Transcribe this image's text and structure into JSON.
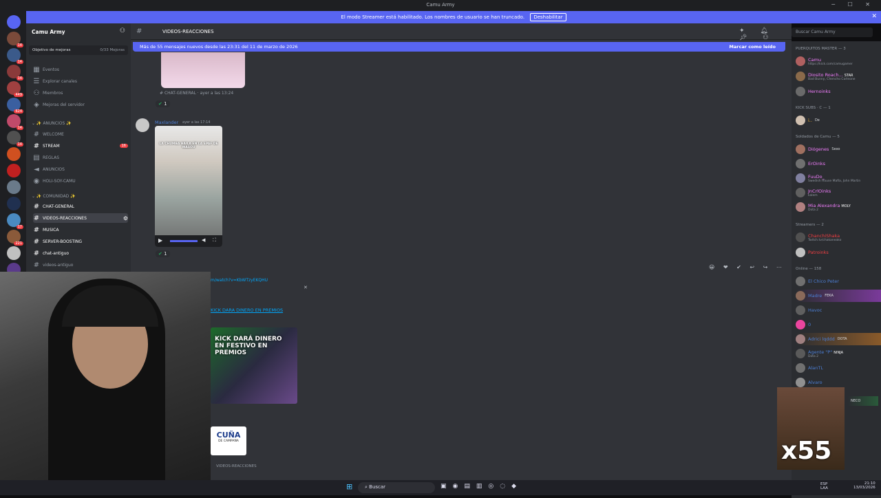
{
  "window": {
    "title": "Camu Army"
  },
  "banner": {
    "text": "El modo Streamer está habilitado. Los nombres de usuario se han truncado.",
    "button": "Deshabilitar"
  },
  "server": {
    "name": "Camu Army",
    "boost_goal": "Objetivo de mejoras",
    "boost_count": "0/33 Mejoras"
  },
  "nav": {
    "events": "Eventos",
    "explore": "Explorar canales",
    "members": "Miembros",
    "boosts": "Mejoras del servidor"
  },
  "categories": {
    "announcements": "ANUNCIOS",
    "community": "COMUNIDAD"
  },
  "channels": [
    "WELCOME",
    "STREAM",
    "REGLAS",
    "ANUNCIOS",
    "HOLI-SOY-CAMU",
    "CHAT-GENERAL",
    "VIDEOS-REACCIONES",
    "MUSICA",
    "SERVER-BOOSTING",
    "chat-antiguo",
    "videos-antiguo"
  ],
  "stream_badge": "16",
  "header": {
    "channel": "VIDEOS-REACCIONES",
    "search_placeholder": "Buscar Camu Army"
  },
  "newmessages": {
    "text": "Más de 55 mensajes nuevos desde las 23:31 del 11 de marzo de 2026",
    "mark_read": "Marcar como leído"
  },
  "messages": {
    "forward_ref": "CHAT-GENERAL",
    "forward_time": "ayer a las 13:24",
    "reaction_count1": "1",
    "author": "Maxlander",
    "time": "ayer a las 17:14",
    "video_caption": "LA CHUMBA BAILA EN LA EPAF DE WASOU",
    "reaction_count2": "1",
    "link": "m/watch?v=KbWTzyEKQHU",
    "link_title": "KICK DARA DINERO EN PREMIOS",
    "thumb_text": "KICK DARÁ DINERO EN FESTIVO EN PREMIOS",
    "banner_text": "CUÑA",
    "banner_sub": "DE CAMPAÑA",
    "composer_ref": "VIDEOS-REACCIONES"
  },
  "members": {
    "sec1": "PUERQUITOS MASTER — 3",
    "m1": "Camu",
    "m1s": "https://kick.com/camugamer",
    "m2": "Diosito Roach...",
    "m2s": "Bad Bunny, Chencho Corleone",
    "m2tag": "STAR",
    "m3": "Hernoinks",
    "sec2": "KICK SUBS · C — 1",
    "m4": "i..",
    "m4tag": "De",
    "sec3": "Soldados de Camu — 5",
    "m5": "Diógenes",
    "m5tag": "Sexo",
    "m6": "ErOinks",
    "m7": "FuuDo_",
    "m7s": "Swedish House Mafia, John Martin",
    "m8": "JnCrlOinks",
    "m8s": "kalem",
    "m9": "Mia Alexandra",
    "m9tag": "MOLY",
    "m9s": "Dota 2",
    "sec4": "Streamers — 2",
    "m10": "ChanchiShaka",
    "m10s": "Twitch.tv/chakaneako",
    "m11": "Patroinks",
    "sec5": "Online — 158",
    "m12": "El Chico Peter",
    "m13": "Madre",
    "m13tag": "FEKA",
    "m14": "Havoc",
    "m15": "0",
    "m16": "Adrici lqddd",
    "m16tag": "DOTA",
    "m17": "Agente \"P\"",
    "m17tag": "NINJA",
    "m17s": "Dota 2",
    "m18": "AlanTL",
    "m19": "Alvaro"
  },
  "overlay": {
    "multiplier": "x55",
    "tag": "NECO"
  },
  "taskbar": {
    "search": "Buscar",
    "lang": "ESP",
    "region": "LAA",
    "time": "21:10",
    "date": "13/03/2026"
  },
  "colors": {
    "accent": "#5865f2",
    "pink": "#f47fff",
    "online": "#23a55a"
  }
}
